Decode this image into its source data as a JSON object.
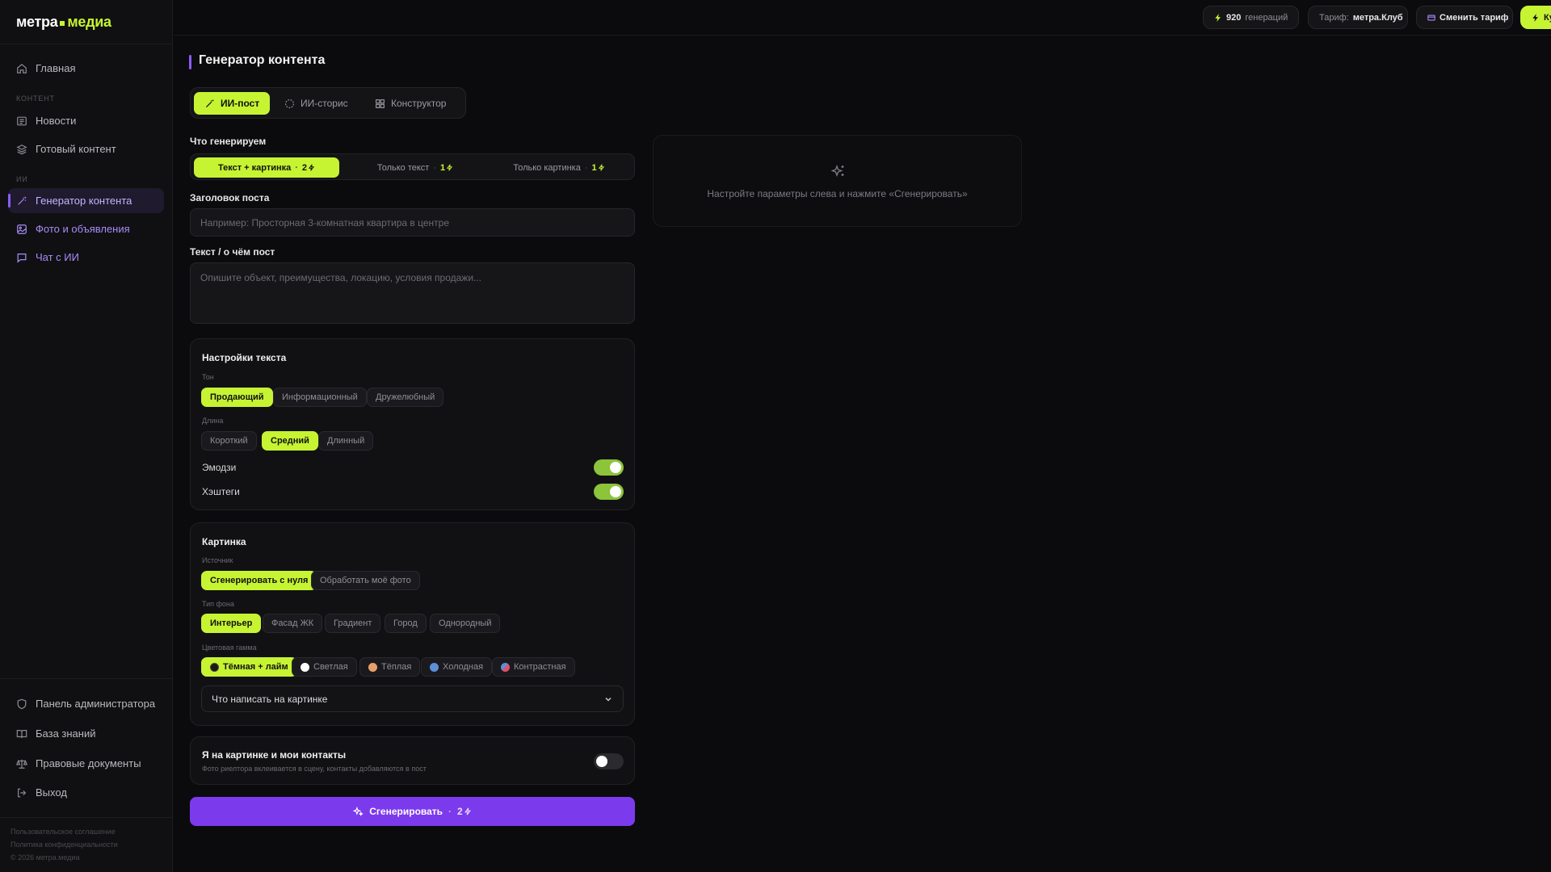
{
  "brand": {
    "left": "метра",
    "right": "медиа"
  },
  "sidebar": {
    "home": "Главная",
    "section_content": "КОНТЕНТ",
    "news": "Новости",
    "ready": "Готовый контент",
    "section_ai": "ИИ",
    "generator": "Генератор контента",
    "photos": "Фото и объявления",
    "chat": "Чат с ИИ",
    "admin": "Панель администратора",
    "kb": "База знаний",
    "legal": "Правовые документы",
    "logout": "Выход",
    "footer": [
      "Пользовательское соглашение",
      "Политика конфиденциальности",
      "© 2026 метра.медиа"
    ]
  },
  "topbar": {
    "gen_count": "920",
    "gen_word": "генераций",
    "tariff_label": "Тариф:",
    "tariff_value": "метра.Клуб",
    "change_tariff": "Сменить тариф",
    "buy_cut": "Ку"
  },
  "page": {
    "title": "Генератор контента"
  },
  "tabs": [
    "ИИ-пост",
    "ИИ-сторис",
    "Конструктор"
  ],
  "what": {
    "label": "Что генерируем",
    "options": [
      {
        "label": "Текст + картинка",
        "cost": "2"
      },
      {
        "label": "Только текст",
        "cost": "1"
      },
      {
        "label": "Только картинка",
        "cost": "1"
      }
    ]
  },
  "post_title": {
    "label": "Заголовок поста",
    "placeholder": "Например: Просторная 3-комнатная квартира в центре"
  },
  "post_text": {
    "label": "Текст / о чём пост",
    "placeholder": "Опишите объект, преимущества, локацию, условия продажи..."
  },
  "text_settings": {
    "title": "Настройки текста",
    "tone_label": "Тон",
    "tones": [
      "Продающий",
      "Информационный",
      "Дружелюбный"
    ],
    "length_label": "Длина",
    "lengths": [
      "Короткий",
      "Средний",
      "Длинный"
    ],
    "emoji": "Эмодзи",
    "hashtags": "Хэштеги"
  },
  "image": {
    "title": "Картинка",
    "source_label": "Источник",
    "sources": [
      "Сгенерировать с нуля",
      "Обработать моё фото"
    ],
    "bg_label": "Тип фона",
    "bgs": [
      "Интерьер",
      "Фасад ЖК",
      "Градиент",
      "Город",
      "Однородный"
    ],
    "palette_label": "Цветовая гамма",
    "palettes": [
      "Тёмная + лайм",
      "Светлая",
      "Тёплая",
      "Холодная",
      "Контрастная"
    ],
    "palette_colors": [
      "#1a1a1a",
      "#ffffff",
      "#e8a06b",
      "#5b8fd6",
      "#e0506b"
    ],
    "overlay_select": "Что написать на картинке"
  },
  "contacts": {
    "title": "Я на картинке и мои контакты",
    "desc": "Фото риелтора вклеивается в сцену, контакты добавляются в пост"
  },
  "generate": {
    "label": "Сгенерировать",
    "cost": "2"
  },
  "preview": {
    "hint": "Настройте параметры слева и нажмите «Сгенерировать»"
  },
  "colors": {
    "accent_lime": "#c6f432",
    "accent_purple": "#7c3aed"
  }
}
